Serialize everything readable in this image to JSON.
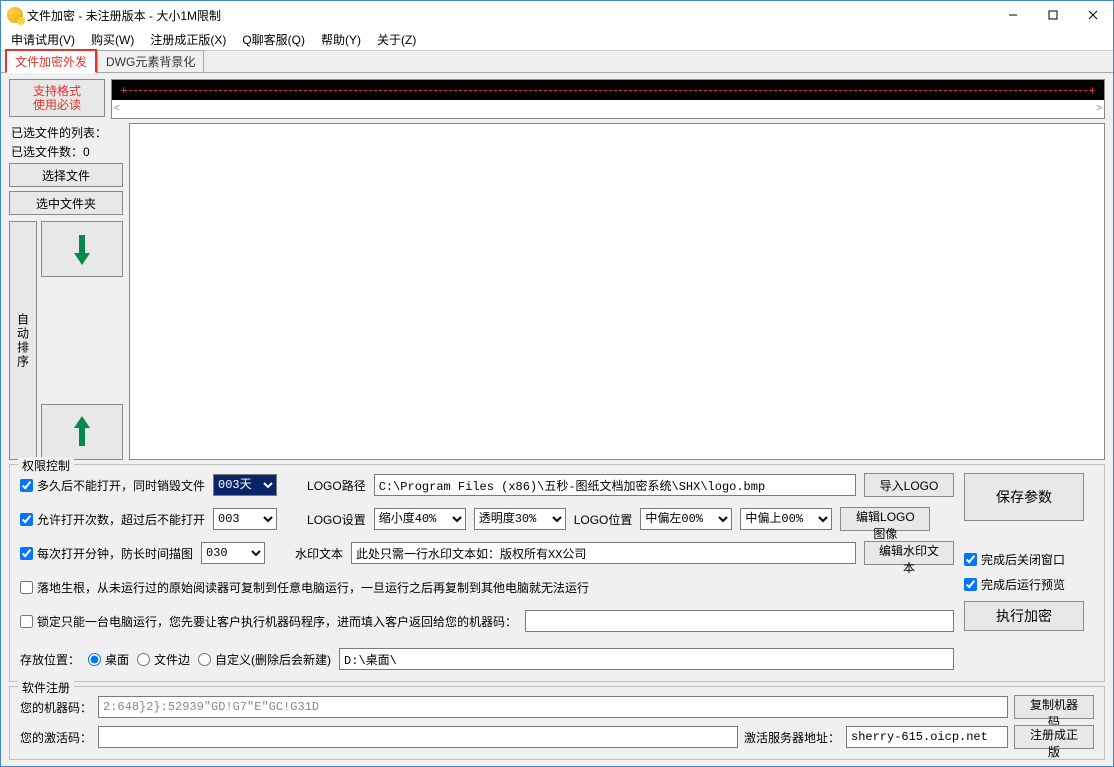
{
  "window": {
    "title": "文件加密 - 未注册版本 - 大小1M限制"
  },
  "menus": [
    "申请试用(V)",
    "购买(W)",
    "注册成正版(X)",
    "Q聊客服(Q)",
    "帮助(Y)",
    "关于(Z)"
  ],
  "tabs": {
    "active": "文件加密外发",
    "other": "DWG元素背景化"
  },
  "topbutton": {
    "line1": "支持格式",
    "line2": "使用必读"
  },
  "filepanel": {
    "listlabel": "已选文件的列表：",
    "countlabel": "已选文件数：0",
    "select_file": "选择文件",
    "select_folder": "选中文件夹",
    "autosort": "自动排序"
  },
  "perm": {
    "legend": "权限控制",
    "r1": {
      "chk": "多久后不能打开，同时销毁文件",
      "val": "003天"
    },
    "r2": {
      "chk": "允许打开次数，超过后不能打开",
      "val": "003"
    },
    "r3": {
      "chk": "每次打开分钟，防长时间描图",
      "val": "030"
    },
    "r4": {
      "chk": "落地生根，从未运行过的原始阅读器可复制到任意电脑运行，一旦运行之后再复制到其他电脑就无法运行"
    },
    "r5": {
      "chk": "锁定只能一台电脑运行，您先要让客户执行机器码程序，进而填入客户返回给您的机器码："
    },
    "logo_path_lbl": "LOGO路径",
    "logo_path": "C:\\Program Files (x86)\\五秒-图纸文档加密系统\\SHX\\logo.bmp",
    "import_logo": "导入LOGO",
    "logo_set_lbl": "LOGO设置",
    "scale": "缩小度40%",
    "opacity": "透明度30%",
    "logo_pos_lbl": "LOGO位置",
    "pos1": "中偏左00%",
    "pos2": "中偏上00%",
    "edit_logo": "编辑LOGO图像",
    "wm_lbl": "水印文本",
    "wm_text": "此处只需一行水印文本如：版权所有XX公司",
    "edit_wm": "编辑水印文本",
    "save_loc_lbl": "存放位置：",
    "loc_desktop": "桌面",
    "loc_fileside": "文件边",
    "loc_custom": "自定义(删除后会新建)",
    "loc_path": "D:\\桌面\\",
    "save_params": "保存参数",
    "close_after": "完成后关闭窗口",
    "preview_after": "完成后运行预览",
    "exec": "执行加密"
  },
  "reg": {
    "legend": "软件注册",
    "machine_lbl": "您的机器码：",
    "machine": "2:648}2}:52939\"GD!G7\"E\"GC!G31D",
    "copy_machine": "复制机器码",
    "activate_lbl": "您的激活码：",
    "server_lbl": "激活服务器地址：",
    "server": "sherry-615.oicp.net",
    "register": "注册成正版"
  }
}
